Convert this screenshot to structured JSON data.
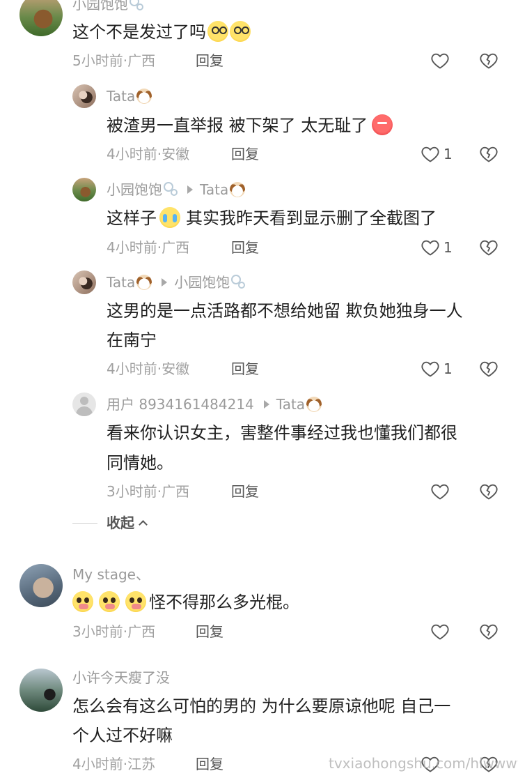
{
  "comments": [
    {
      "name": "小园饱饱",
      "text": "这个不是发过了吗",
      "time": "5小时前",
      "location": "广西",
      "reply_label": "回复",
      "likes": ""
    },
    {
      "name": "Tata",
      "text": "被渣男一直举报 被下架了 太无耻了",
      "time": "4小时前",
      "location": "安徽",
      "reply_label": "回复",
      "likes": "1"
    },
    {
      "name": "小园饱饱",
      "reply_to": "Tata",
      "text_a": "这样子",
      "text_b": "其实我昨天看到显示删了全截图了",
      "time": "4小时前",
      "location": "广西",
      "reply_label": "回复",
      "likes": "1"
    },
    {
      "name": "Tata",
      "reply_to": "小园饱饱",
      "text_line1": "这男的是一点活路都不想给她留 欺负她独身一人",
      "text_line2": "在南宁",
      "time": "4小时前",
      "location": "安徽",
      "reply_label": "回复",
      "likes": "1"
    },
    {
      "name": "用户 8934161484214",
      "reply_to": "Tata",
      "text_line1": "看来你认识女主，害整件事经过我也懂我们都很",
      "text_line2": "同情她。",
      "time": "3小时前",
      "location": "广西",
      "reply_label": "回复",
      "likes": ""
    },
    {
      "name": "My  stage、",
      "text": "怪不得那么多光棍。",
      "time": "3小时前",
      "location": "广西",
      "reply_label": "回复",
      "likes": ""
    },
    {
      "name": "小许今天瘦了没",
      "text_line1": "怎么会有这么可怕的男的 为什么要原谅他呢 自己一",
      "text_line2": "个人过不好嘛",
      "time": "4小时前",
      "location": "江苏",
      "reply_label": "回复",
      "likes": ""
    }
  ],
  "collapse_label": "收起",
  "meta_separator": "·",
  "watermark": "tvxiaohongshu.com/hlwwwww",
  "icons": {
    "like": "heart-outline-icon",
    "dislike": "broken-heart-icon",
    "collapse": "chevron-up-icon"
  }
}
